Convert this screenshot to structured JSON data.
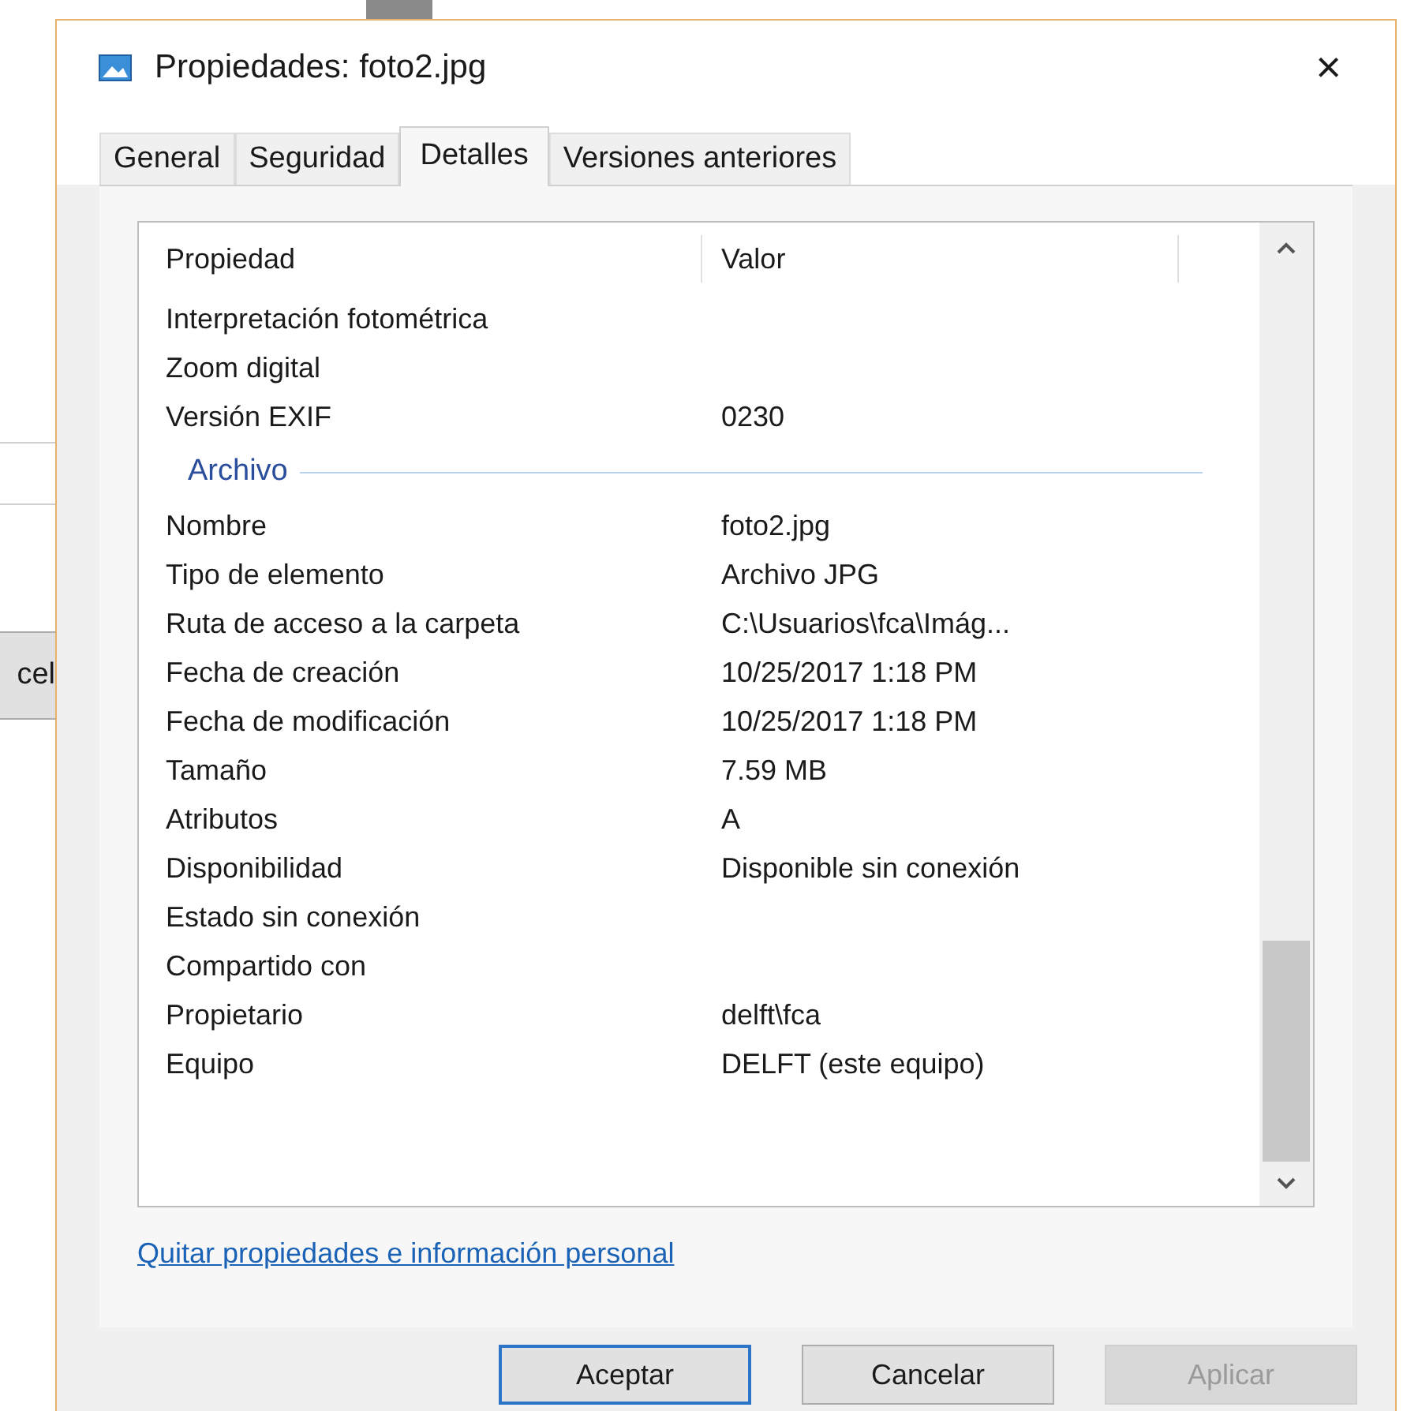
{
  "background_window": {
    "button": "cel"
  },
  "window": {
    "title": "Propiedades: foto2.jpg",
    "close": "×"
  },
  "tabs": [
    {
      "label": "General",
      "selected": false
    },
    {
      "label": "Seguridad",
      "selected": false
    },
    {
      "label": "Detalles",
      "selected": true
    },
    {
      "label": "Versiones anteriores",
      "selected": false
    }
  ],
  "table": {
    "columns": [
      "Propiedad",
      "Valor"
    ],
    "rows": [
      {
        "kind": "row",
        "name": "Interpretación fotométrica",
        "value": ""
      },
      {
        "kind": "row",
        "name": "Zoom digital",
        "value": ""
      },
      {
        "kind": "row",
        "name": "Versión EXIF",
        "value": "0230"
      },
      {
        "kind": "group",
        "name": "Archivo"
      },
      {
        "kind": "row",
        "name": "Nombre",
        "value": "foto2.jpg"
      },
      {
        "kind": "row",
        "name": "Tipo de elemento",
        "value": "Archivo JPG"
      },
      {
        "kind": "row",
        "name": "Ruta de acceso a la carpeta",
        "value": "C:\\Usuarios\\fca\\Imág..."
      },
      {
        "kind": "row",
        "name": "Fecha de creación",
        "value": "10/25/2017 1:18 PM"
      },
      {
        "kind": "row",
        "name": "Fecha de modificación",
        "value": "10/25/2017 1:18 PM"
      },
      {
        "kind": "row",
        "name": "Tamaño",
        "value": "7.59 MB"
      },
      {
        "kind": "row",
        "name": "Atributos",
        "value": "A"
      },
      {
        "kind": "row",
        "name": "Disponibilidad",
        "value": "Disponible sin conexión"
      },
      {
        "kind": "row",
        "name": "Estado sin conexión",
        "value": ""
      },
      {
        "kind": "row",
        "name": "Compartido con",
        "value": ""
      },
      {
        "kind": "row",
        "name": "Propietario",
        "value": "delft\\fca"
      },
      {
        "kind": "row",
        "name": "Equipo",
        "value": "DELFT (este equipo)"
      }
    ]
  },
  "link": "Quitar propiedades e información personal",
  "buttons": [
    {
      "label": "Aceptar",
      "kind": "default",
      "disabled": false
    },
    {
      "label": "Cancelar",
      "kind": "normal",
      "disabled": false
    },
    {
      "label": "Aplicar",
      "kind": "normal",
      "disabled": true
    }
  ]
}
